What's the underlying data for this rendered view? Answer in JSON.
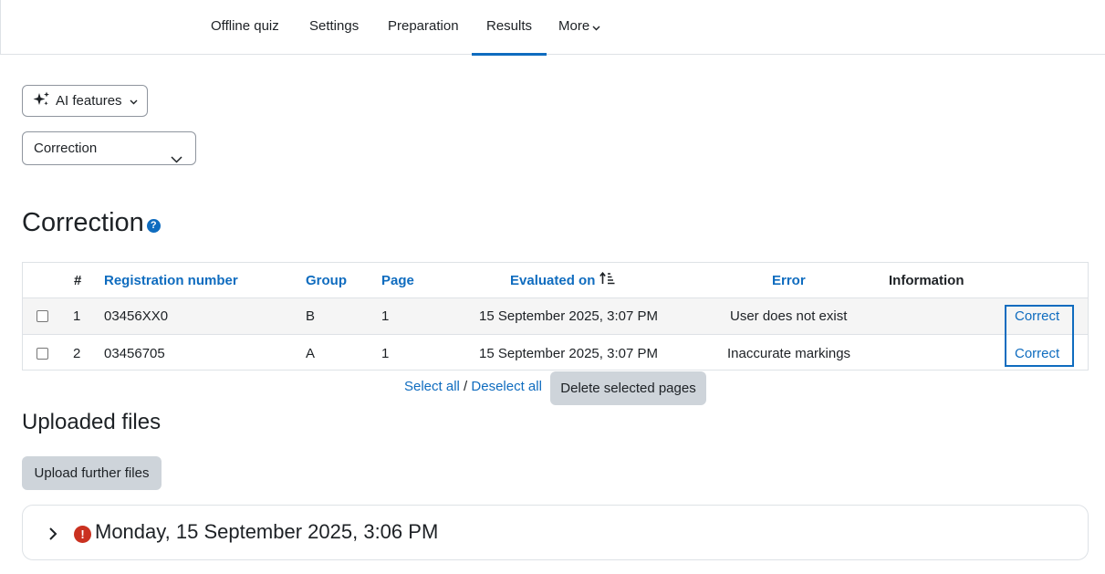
{
  "nav": {
    "tabs": [
      {
        "label": "Offline quiz"
      },
      {
        "label": "Settings"
      },
      {
        "label": "Preparation"
      },
      {
        "label": "Results"
      },
      {
        "label": "More"
      }
    ],
    "active_tab": "Results"
  },
  "ai_button": {
    "label": "AI features",
    "icon": "sparkles-icon"
  },
  "mode_select": {
    "value": "Correction"
  },
  "correction": {
    "heading": "Correction",
    "help_icon": "?",
    "columns": {
      "num": "#",
      "registration": "Registration number",
      "group": "Group",
      "page": "Page",
      "evaluated": "Evaluated on",
      "error": "Error",
      "information": "Information"
    },
    "rows": [
      {
        "num": "1",
        "registration": "03456XX0",
        "group": "B",
        "page": "1",
        "evaluated": "15 September 2025, 3:07 PM",
        "error": "User does not exist",
        "information": "",
        "action": "Correct"
      },
      {
        "num": "2",
        "registration": "03456705",
        "group": "A",
        "page": "1",
        "evaluated": "15 September 2025, 3:07 PM",
        "error": "Inaccurate markings",
        "information": "",
        "action": "Correct"
      }
    ],
    "select_all": "Select all",
    "separator": "/",
    "deselect_all": "Deselect all",
    "delete_button": "Delete selected pages"
  },
  "uploaded": {
    "heading": "Uploaded files",
    "upload_button": "Upload further files",
    "file_entry": {
      "title": "Monday, 15 September 2025, 3:06 PM",
      "status": "error",
      "error_mark": "!"
    }
  },
  "colors": {
    "link": "#0f6cbf",
    "error": "#ca3120",
    "button_secondary": "#ced4da"
  }
}
